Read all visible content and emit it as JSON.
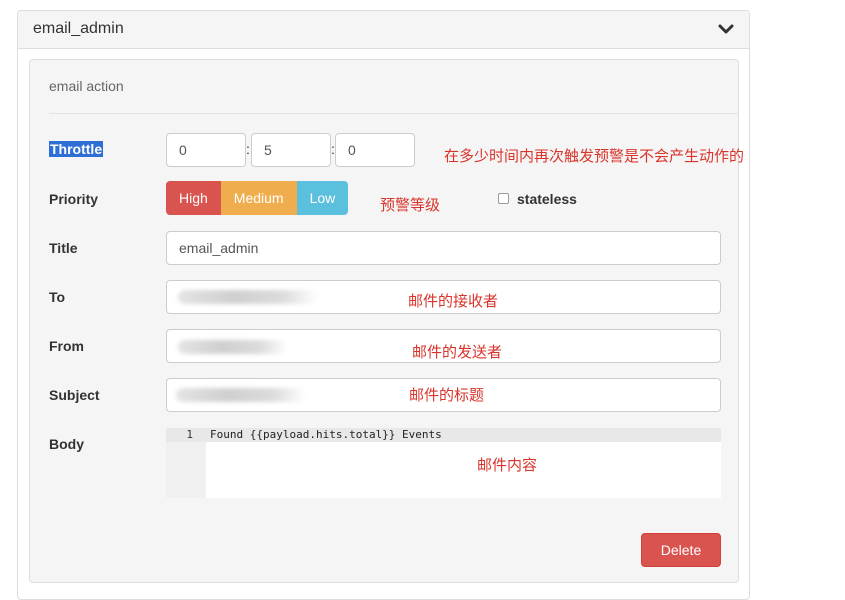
{
  "panel": {
    "title": "email_admin"
  },
  "action": {
    "title": "email action"
  },
  "throttle": {
    "label": "Throttle",
    "hours": "0",
    "minutes": "5",
    "seconds": "0",
    "separator": ":"
  },
  "priority": {
    "label": "Priority",
    "options": [
      "High",
      "Medium",
      "Low"
    ]
  },
  "stateless": {
    "label": "stateless",
    "checked": false
  },
  "title_field": {
    "label": "Title",
    "value": "email_admin"
  },
  "to_field": {
    "label": "To"
  },
  "from_field": {
    "label": "From"
  },
  "subject_field": {
    "label": "Subject"
  },
  "body_field": {
    "label": "Body",
    "line_number": "1",
    "code": "Found {{payload.hits.total}} Events"
  },
  "annotations": {
    "throttle": "在多少时间内再次触发预警是不会产生动作的",
    "priority": "预警等级",
    "to": "邮件的接收者",
    "from": "邮件的发送者",
    "subject": "邮件的标题",
    "body": "邮件内容"
  },
  "delete_label": "Delete",
  "colors": {
    "danger": "#d9534f",
    "warning": "#f0ad4e",
    "info": "#5bc0de",
    "annotation": "#d9342b"
  }
}
